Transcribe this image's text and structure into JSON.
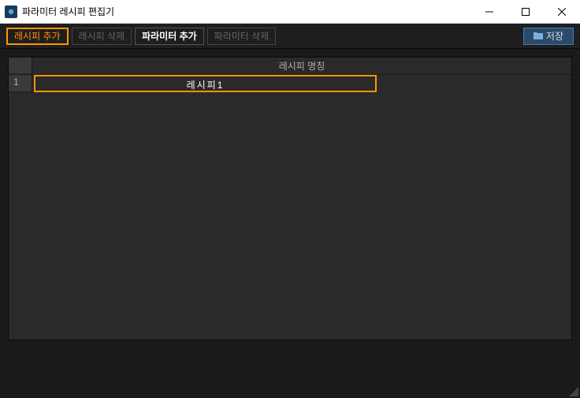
{
  "window": {
    "title": "파라미터 레시피 편집기"
  },
  "toolbar": {
    "add_recipe": "레시피 추가",
    "delete_recipe": "레시피 삭제",
    "add_param": "파라미터 추가",
    "delete_param": "파라미터 삭제",
    "save": "저장"
  },
  "table": {
    "header_name": "레시피 명칭",
    "rows": [
      {
        "num": "1",
        "name": "레시피1"
      }
    ]
  }
}
